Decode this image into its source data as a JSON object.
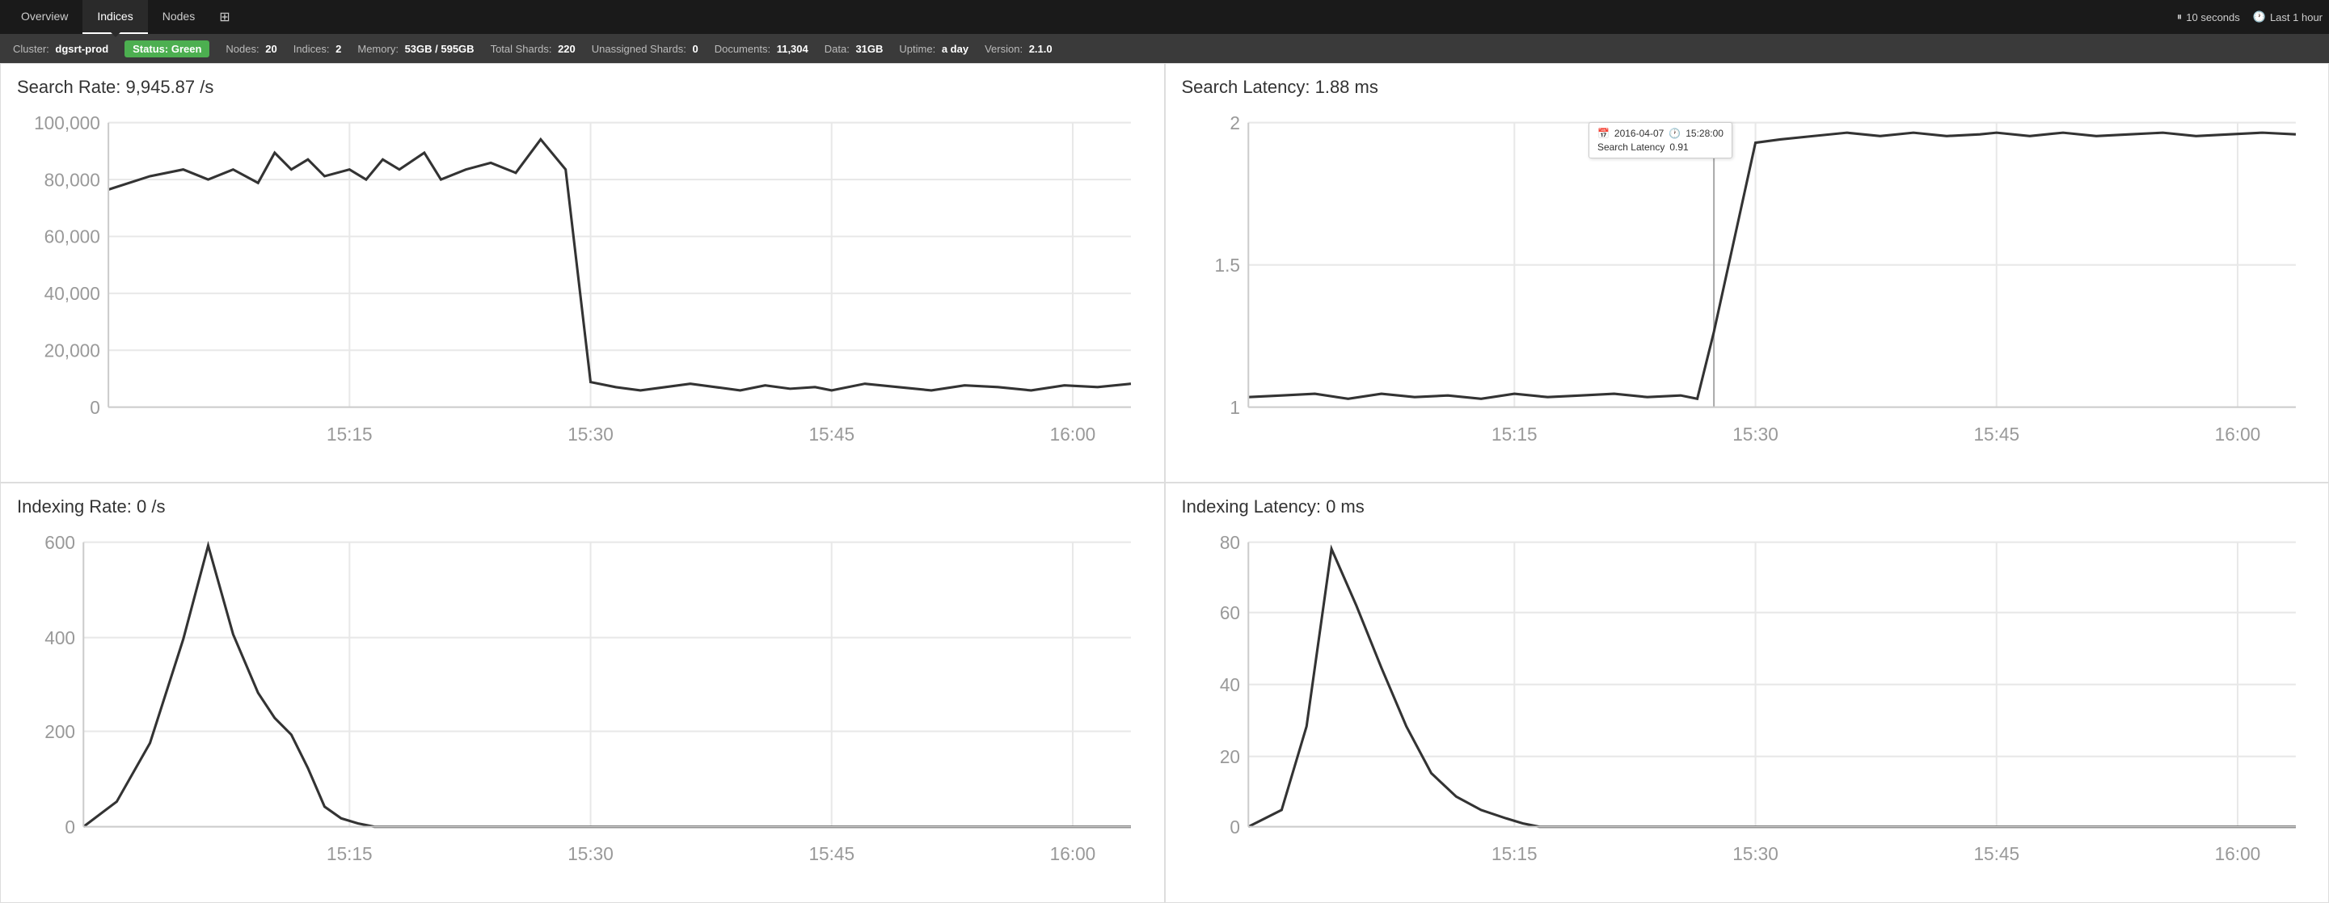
{
  "nav": {
    "tabs": [
      {
        "label": "Overview",
        "active": false
      },
      {
        "label": "Indices",
        "active": true
      },
      {
        "label": "Nodes",
        "active": false
      }
    ],
    "refresh_label": "10 seconds",
    "timerange_label": "Last 1 hour"
  },
  "statusbar": {
    "cluster_label": "Cluster:",
    "cluster_name": "dgsrt-prod",
    "status_label": "Status:",
    "status_value": "Green",
    "nodes_label": "Nodes:",
    "nodes_value": "20",
    "indices_label": "Indices:",
    "indices_value": "2",
    "memory_label": "Memory:",
    "memory_value": "53GB / 595GB",
    "total_shards_label": "Total Shards:",
    "total_shards_value": "220",
    "unassigned_label": "Unassigned Shards:",
    "unassigned_value": "0",
    "documents_label": "Documents:",
    "documents_value": "11,304",
    "data_label": "Data:",
    "data_value": "31GB",
    "uptime_label": "Uptime:",
    "uptime_value": "a day",
    "version_label": "Version:",
    "version_value": "2.1.0"
  },
  "charts": {
    "search_rate": {
      "title": "Search Rate: 9,945.87 /s",
      "y_labels": [
        "100,000",
        "80,000",
        "60,000",
        "40,000",
        "20,000",
        "0"
      ],
      "x_labels": [
        "15:15",
        "15:30",
        "15:45",
        "16:00"
      ]
    },
    "search_latency": {
      "title": "Search Latency: 1.88 ms",
      "y_labels": [
        "2",
        "1.5",
        "1"
      ],
      "x_labels": [
        "15:15",
        "15:30",
        "15:45",
        "16:00"
      ],
      "tooltip": {
        "date": "2016-04-07",
        "time": "15:28:00",
        "label": "Search Latency",
        "value": "0.91"
      }
    },
    "indexing_rate": {
      "title": "Indexing Rate: 0 /s",
      "y_labels": [
        "600",
        "400",
        "200",
        "0"
      ],
      "x_labels": [
        "15:15",
        "15:30",
        "15:45",
        "16:00"
      ]
    },
    "indexing_latency": {
      "title": "Indexing Latency: 0 ms",
      "y_labels": [
        "80",
        "60",
        "40",
        "20",
        "0"
      ],
      "x_labels": [
        "15:15",
        "15:30",
        "15:45",
        "16:00"
      ]
    }
  }
}
